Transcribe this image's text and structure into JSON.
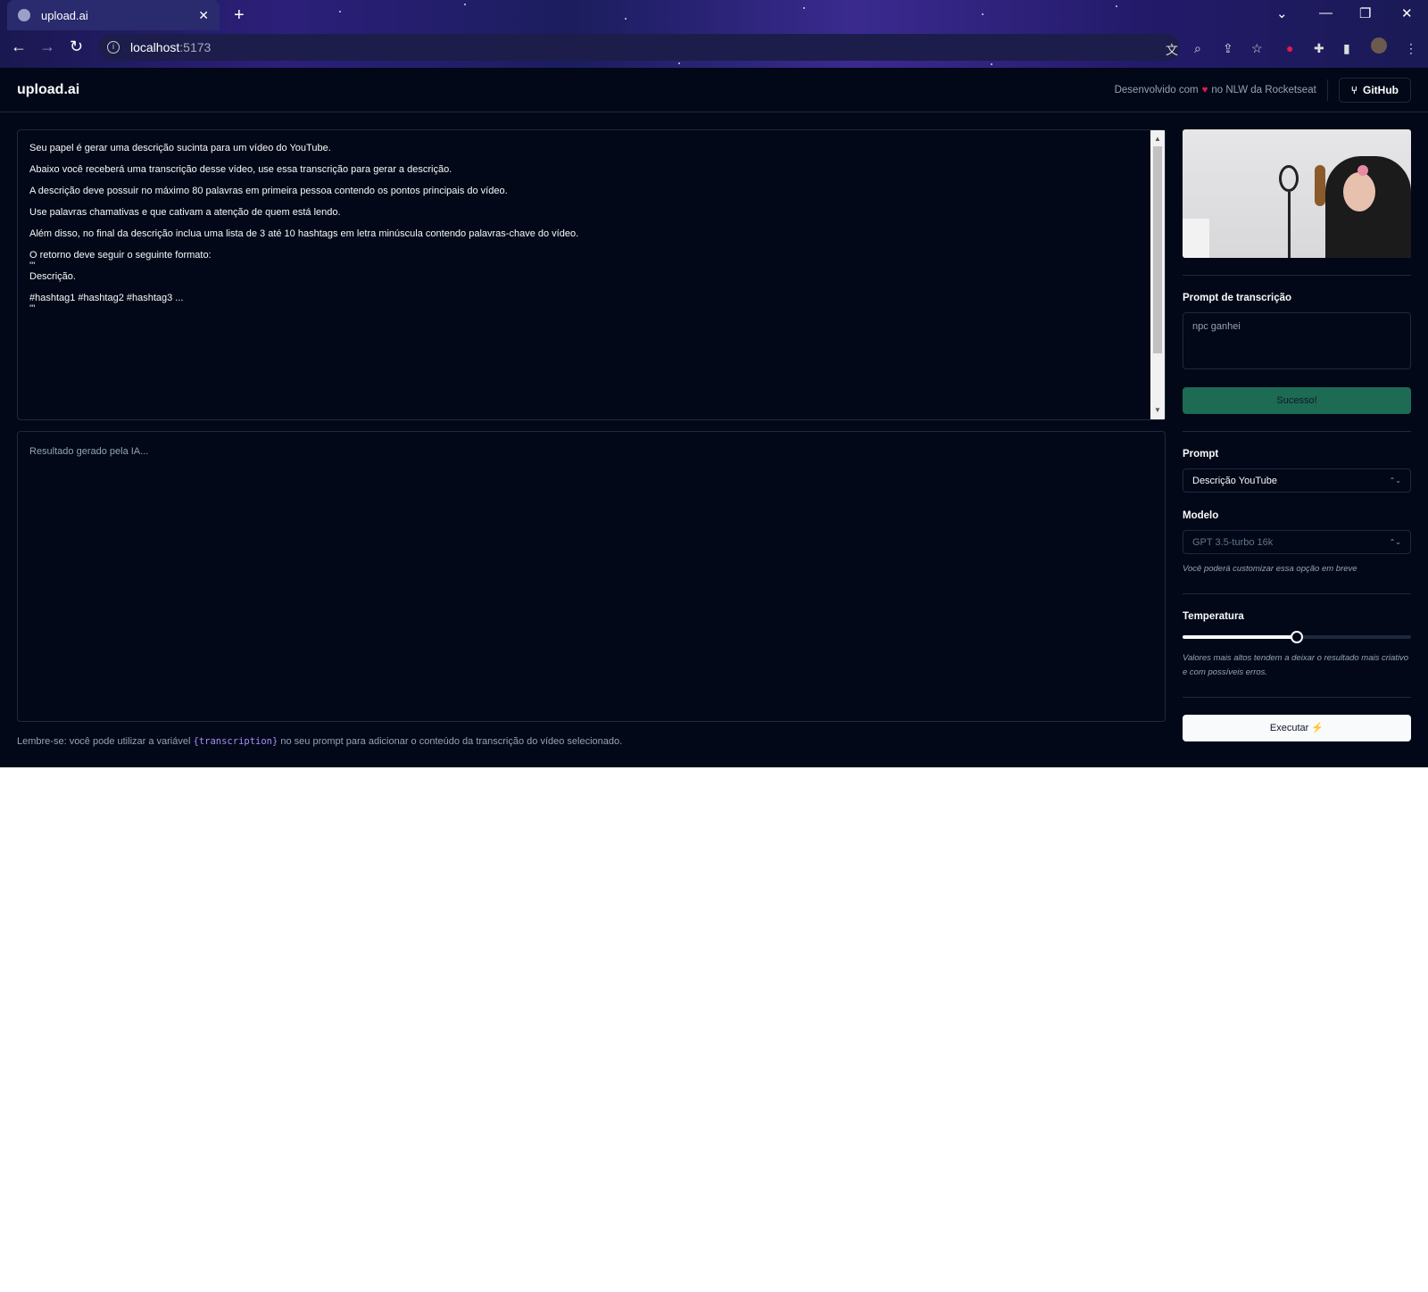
{
  "browser": {
    "tab_title": "upload.ai",
    "url_host": "localhost",
    "url_port": ":5173"
  },
  "header": {
    "logo": "upload.ai",
    "credit_prefix": "Desenvolvido com",
    "credit_suffix": "no NLW da Rocketseat",
    "github_label": "GitHub"
  },
  "prompt": {
    "text": "Seu papel é gerar uma descrição sucinta para um vídeo do YouTube.\n\nAbaixo você receberá uma transcrição desse vídeo, use essa transcrição para gerar a descrição.\n\nA descrição deve possuir no máximo 80 palavras em primeira pessoa contendo os pontos principais do vídeo.\n\nUse palavras chamativas e que cativam a atenção de quem está lendo.\n\nAlém disso, no final da descrição inclua uma lista de 3 até 10 hashtags em letra minúscula contendo palavras-chave do vídeo.\n\nO retorno deve seguir o seguinte formato:\n'''\nDescrição.\n\n#hashtag1 #hashtag2 #hashtag3 ...\n'''"
  },
  "result": {
    "placeholder": "Resultado gerado pela IA..."
  },
  "tip": {
    "prefix": "Lembre-se: você pode utilizar a variável",
    "variable": "{transcription}",
    "suffix": "no seu prompt para adicionar o conteúdo da transcrição do vídeo selecionado."
  },
  "sidebar": {
    "transcription_label": "Prompt de transcrição",
    "transcription_value": "npc ganhei",
    "success_button": "Sucesso!",
    "prompt_label": "Prompt",
    "prompt_selected": "Descrição YouTube",
    "model_label": "Modelo",
    "model_selected": "GPT 3.5-turbo 16k",
    "model_hint": "Você poderá customizar essa opção em breve",
    "temperature_label": "Temperatura",
    "temperature_value": 0.5,
    "temperature_hint": "Valores mais altos tendem a deixar o resultado mais criativo e com possíveis erros.",
    "execute_button": "Executar"
  },
  "colors": {
    "background": "#020817",
    "border": "#1e293b",
    "success": "#1d6b52",
    "accent_code": "#a78bfa",
    "heart": "#e11d48"
  }
}
